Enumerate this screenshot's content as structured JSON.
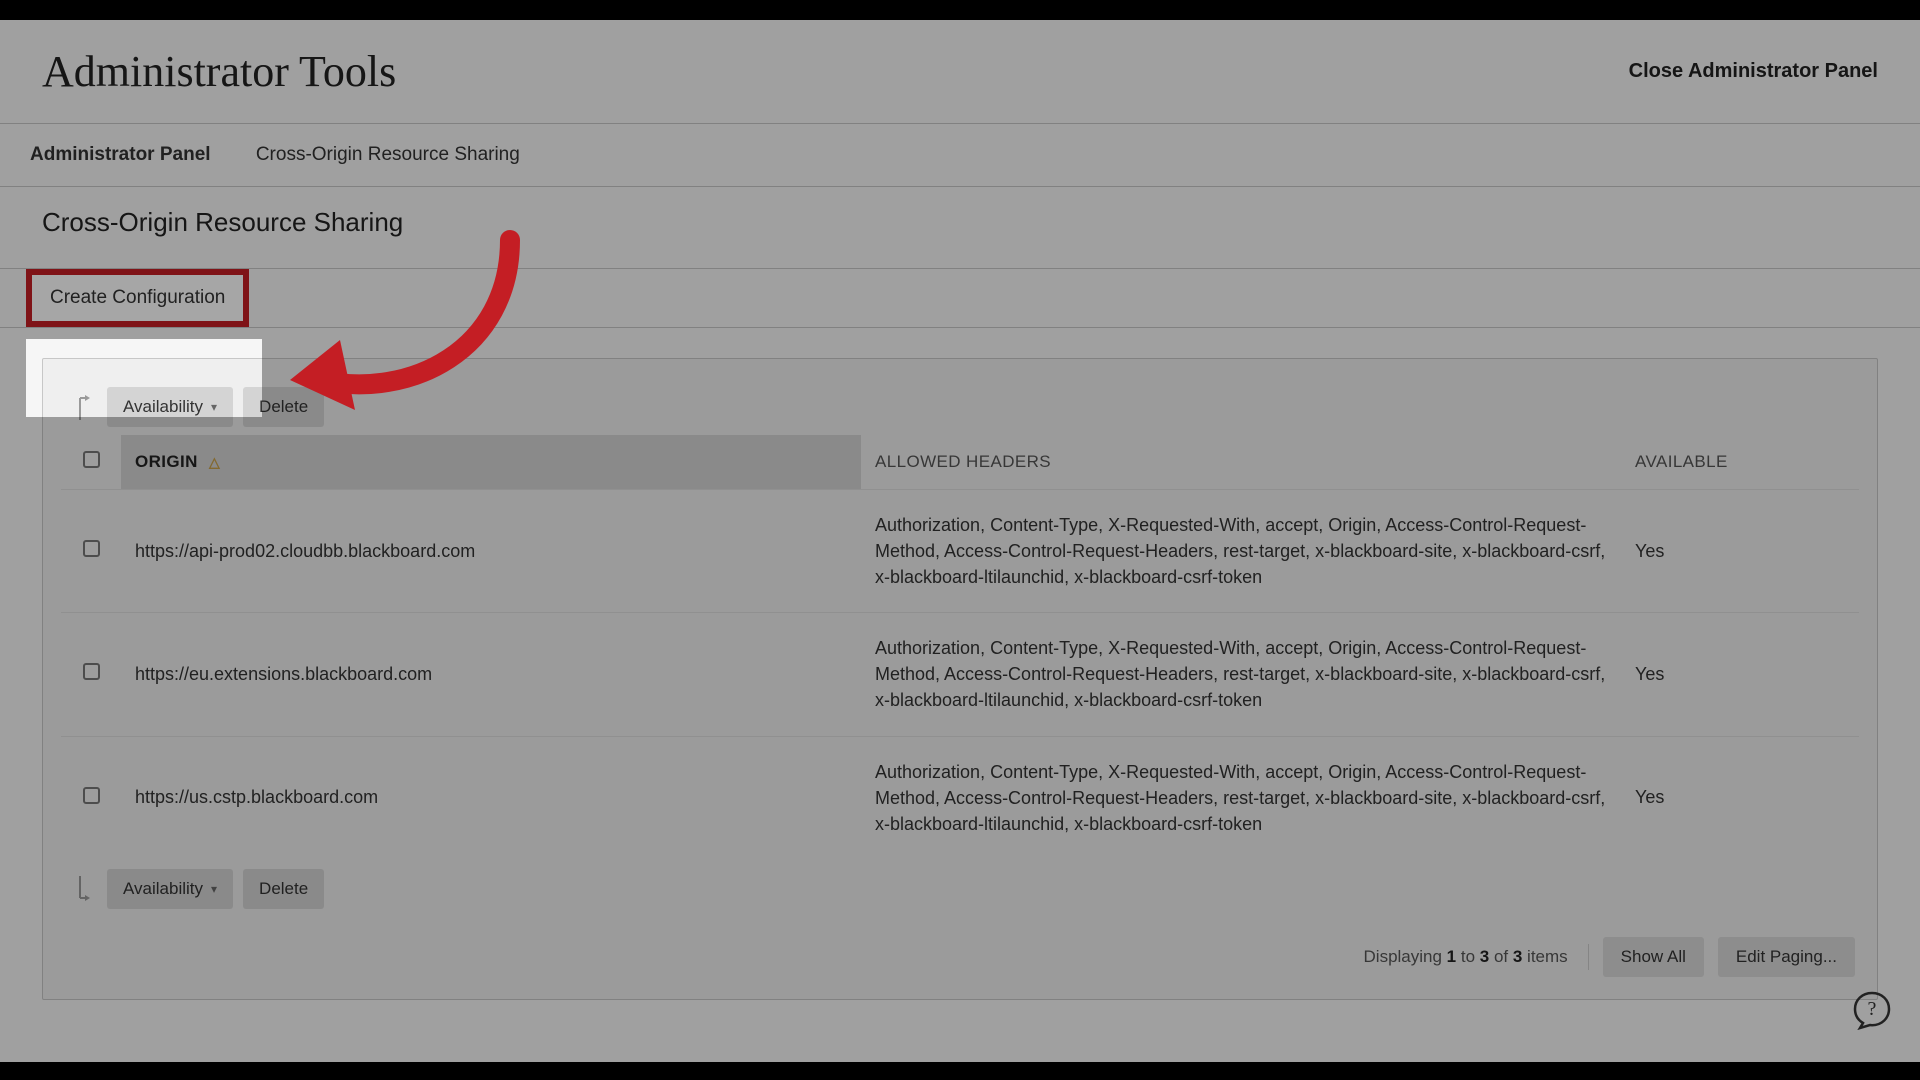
{
  "header": {
    "title": "Administrator Tools",
    "close_label": "Close Administrator Panel"
  },
  "breadcrumb": {
    "items": [
      "Administrator Panel",
      "Cross-Origin Resource Sharing"
    ]
  },
  "subtitle": "Cross-Origin Resource Sharing",
  "create_button_label": "Create Configuration",
  "toolbar": {
    "availability_label": "Availability",
    "delete_label": "Delete"
  },
  "columns": {
    "origin": "ORIGIN",
    "allowed_headers": "ALLOWED HEADERS",
    "available": "AVAILABLE"
  },
  "rows": [
    {
      "origin": "https://api-prod02.cloudbb.blackboard.com",
      "allowed_headers": "Authorization, Content-Type, X-Requested-With, accept, Origin, Access-Control-Request-Method, Access-Control-Request-Headers, rest-target, x-blackboard-site, x-blackboard-csrf, x-blackboard-ltilaunchid, x-blackboard-csrf-token",
      "available": "Yes"
    },
    {
      "origin": "https://eu.extensions.blackboard.com",
      "allowed_headers": "Authorization, Content-Type, X-Requested-With, accept, Origin, Access-Control-Request-Method, Access-Control-Request-Headers, rest-target, x-blackboard-site, x-blackboard-csrf, x-blackboard-ltilaunchid, x-blackboard-csrf-token",
      "available": "Yes"
    },
    {
      "origin": "https://us.cstp.blackboard.com",
      "allowed_headers": "Authorization, Content-Type, X-Requested-With, accept, Origin, Access-Control-Request-Method, Access-Control-Request-Headers, rest-target, x-blackboard-site, x-blackboard-csrf, x-blackboard-ltilaunchid, x-blackboard-csrf-token",
      "available": "Yes"
    }
  ],
  "pagination": {
    "prefix": "Displaying ",
    "from": "1",
    "to_word": " to ",
    "to": "3",
    "of_word": " of ",
    "total": "3",
    "suffix": " items",
    "show_all_label": "Show All",
    "edit_paging_label": "Edit Paging..."
  },
  "annotation": {
    "highlight_color": "#c41e24"
  }
}
